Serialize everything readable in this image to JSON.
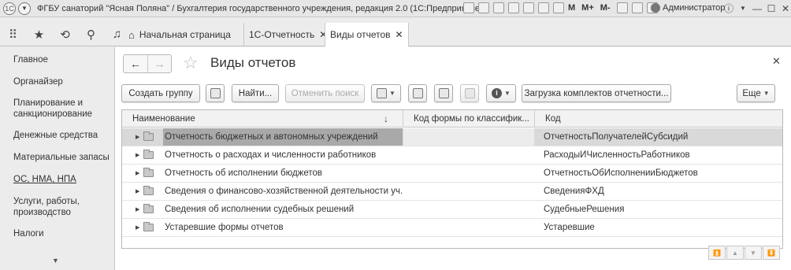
{
  "titlebar": {
    "title": "ФГБУ санаторий \"Ясная Поляна\" / Бухгалтерия государственного учреждения, редакция 2.0  (1С:Предприятие)",
    "m_labels": [
      "M",
      "M+",
      "M-"
    ],
    "user": "Администратор"
  },
  "tabs": {
    "home": "Начальная страница",
    "items": [
      {
        "label": "1С-Отчетность",
        "close": "✕"
      },
      {
        "label": "Виды отчетов",
        "close": "✕"
      }
    ]
  },
  "sidebar": {
    "items": [
      {
        "label": "Главное"
      },
      {
        "label": "Органайзер"
      },
      {
        "label": "Планирование и санкционирование"
      },
      {
        "label": "Денежные средства"
      },
      {
        "label": "Материальные запасы"
      },
      {
        "label": "ОС, НМА, НПА"
      },
      {
        "label": "Услуги, работы, производство"
      },
      {
        "label": "Налоги"
      }
    ]
  },
  "main": {
    "title": "Виды отчетов",
    "toolbar": {
      "create_group": "Создать группу",
      "find": "Найти...",
      "cancel_search": "Отменить поиск",
      "load_kits": "Загрузка комплектов отчетности...",
      "more": "Еще"
    },
    "table": {
      "columns": [
        "Наименование",
        "Код формы по классифик...",
        "Код"
      ],
      "rows": [
        {
          "name": "Отчетность бюджетных и автономных учреждений",
          "form_code": "",
          "code": "ОтчетностьПолучателейСубсидий",
          "selected": true
        },
        {
          "name": "Отчетность о расходах и численности работников",
          "form_code": "",
          "code": "РасходыИЧисленностьРаботников",
          "selected": false
        },
        {
          "name": "Отчетность об исполнении бюджетов",
          "form_code": "",
          "code": "ОтчетностьОбИсполненииБюджетов",
          "selected": false
        },
        {
          "name": "Сведения о финансово-хозяйственной деятельности уч...",
          "form_code": "",
          "code": "СведенияФХД",
          "selected": false
        },
        {
          "name": "Сведения об исполнении судебных решений",
          "form_code": "",
          "code": "СудебныеРешения",
          "selected": false
        },
        {
          "name": "Устаревшие формы отчетов",
          "form_code": "",
          "code": "Устаревшие",
          "selected": false
        }
      ]
    }
  }
}
